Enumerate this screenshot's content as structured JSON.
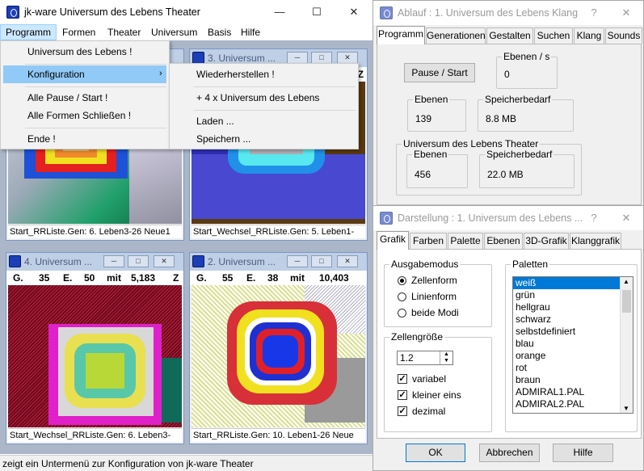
{
  "main_window": {
    "title": "jk-ware Universum des Lebens Theater",
    "status": "zeigt ein Untermenü zur Konfiguration von jk-ware Theater"
  },
  "menu": [
    "Programm",
    "Formen",
    "Theater",
    "Universum",
    "Basis",
    "Hilfe"
  ],
  "programm_menu": {
    "items": [
      "Universum des Lebens !",
      "Konfiguration",
      "Alle Pause / Start !",
      "Alle Formen Schließen !",
      "Ende !"
    ]
  },
  "config_submenu": {
    "items": [
      "Wiederherstellen !",
      "+ 4 x Universum des Lebens",
      "Laden ...",
      "Speichern ..."
    ]
  },
  "children": [
    {
      "title": "",
      "stats": {
        "g": "",
        "e": "",
        "mit": "",
        "val": ""
      },
      "caption": "Start_RRListe.Gen: 6. Leben3-26 Neue1"
    },
    {
      "title": "3. Universum ...",
      "stats": {
        "g": "",
        "e": "",
        "mit": "",
        "val": "Z"
      },
      "caption": "Start_Wechsel_RRListe.Gen: 5. Leben1-"
    },
    {
      "title": "4. Universum ...",
      "stats": {
        "g": "G.",
        "gv": "35",
        "e": "E.",
        "ev": "50",
        "mit": "mit",
        "val": "5,183",
        "z": "Z"
      },
      "caption": "Start_Wechsel_RRListe.Gen: 6. Leben3-"
    },
    {
      "title": "2. Universum ...",
      "stats": {
        "g": "G.",
        "gv": "55",
        "e": "E.",
        "ev": "38",
        "mit": "mit",
        "val": "10,403"
      },
      "caption": "Start_RRListe.Gen: 10. Leben1-26 Neue"
    }
  ],
  "ablauf": {
    "title": "Ablauf : 1. Universum des Lebens Klang",
    "tabs": [
      "Programm",
      "Generationen",
      "Gestalten",
      "Suchen",
      "Klang",
      "Sounds"
    ],
    "pause_button": "Pause / Start",
    "ebenen_s": {
      "label": "Ebenen / s",
      "value": "0"
    },
    "ebenen": {
      "label": "Ebenen",
      "value": "139"
    },
    "speicher": {
      "label": "Speicherbedarf",
      "value": "8.8 MB"
    },
    "group_title": "Universum des Lebens Theater",
    "ebenen2": {
      "label": "Ebenen",
      "value": "456"
    },
    "speicher2": {
      "label": "Speicherbedarf",
      "value": "22.0 MB"
    }
  },
  "darstellung": {
    "title": "Darstellung : 1. Universum des Lebens ...",
    "tabs": [
      "Grafik",
      "Farben",
      "Palette",
      "Ebenen",
      "3D-Grafik",
      "Klanggrafik"
    ],
    "ausgabemodus": {
      "title": "Ausgabemodus",
      "options": [
        "Zellenform",
        "Linienform",
        "beide Modi"
      ],
      "selected": "Zellenform"
    },
    "zellengroesse": {
      "title": "Zellengröße",
      "value": "1.2",
      "checks": [
        "variabel",
        "kleiner eins",
        "dezimal"
      ]
    },
    "paletten": {
      "title": "Paletten",
      "items": [
        "weiß",
        "grün",
        "hellgrau",
        "schwarz",
        "selbstdefiniert",
        "blau",
        "orange",
        "rot",
        "braun",
        "ADMIRAL1.PAL",
        "ADMIRAL2.PAL"
      ],
      "selected": "weiß"
    },
    "buttons": {
      "ok": "OK",
      "cancel": "Abbrechen",
      "help": "Hilfe"
    }
  },
  "colors": {
    "accent": "#0078d7",
    "menu_highlight": "#91c9f7",
    "child_title": "#bfcfe5"
  }
}
